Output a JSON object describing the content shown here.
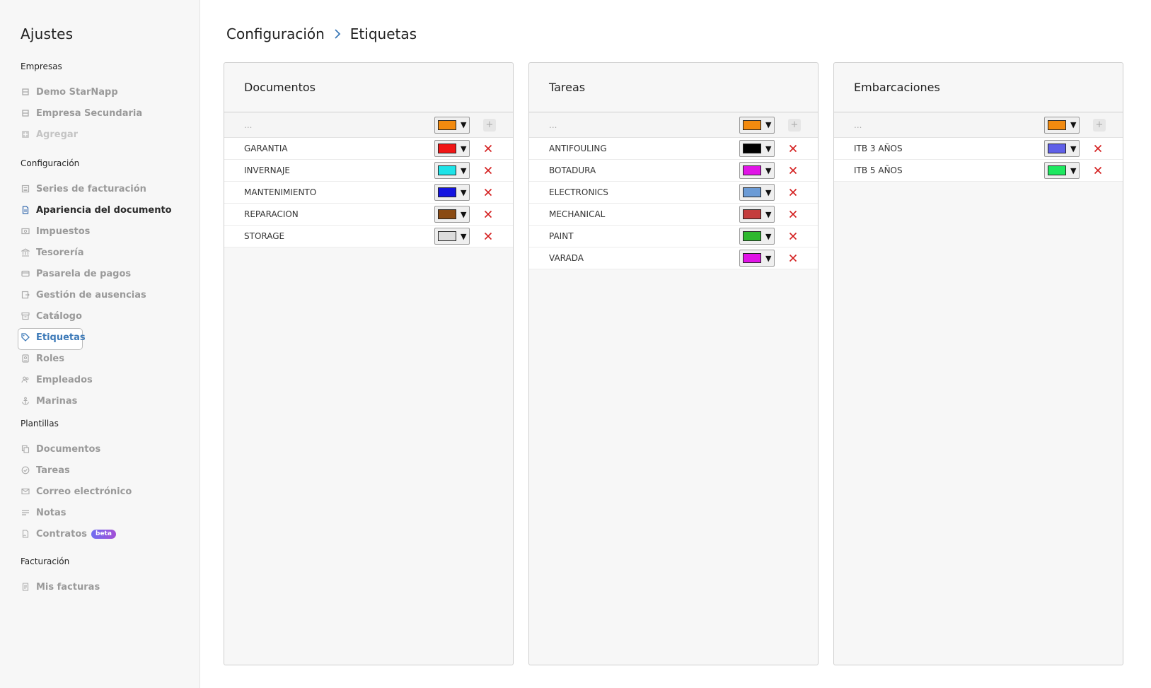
{
  "sidebar": {
    "title": "Ajustes",
    "sections": [
      {
        "title": "Empresas",
        "items": [
          {
            "label": "Demo StarNapp",
            "icon": "building-icon",
            "state": "normal"
          },
          {
            "label": "Empresa Secundaria",
            "icon": "building-icon",
            "state": "normal"
          },
          {
            "label": "Agregar",
            "icon": "plus-square-icon",
            "state": "disabled"
          }
        ]
      },
      {
        "title": "Configuración",
        "items": [
          {
            "label": "Series de facturación",
            "icon": "list-icon",
            "state": "normal"
          },
          {
            "label": "Apariencia del documento",
            "icon": "document-icon",
            "state": "dark"
          },
          {
            "label": "Impuestos",
            "icon": "money-icon",
            "state": "normal"
          },
          {
            "label": "Tesorería",
            "icon": "bank-icon",
            "state": "normal"
          },
          {
            "label": "Pasarela de pagos",
            "icon": "card-icon",
            "state": "normal"
          },
          {
            "label": "Gestión de ausencias",
            "icon": "calendar-out-icon",
            "state": "normal"
          },
          {
            "label": "Catálogo",
            "icon": "archive-icon",
            "state": "normal"
          },
          {
            "label": "Etiquetas",
            "icon": "tag-icon",
            "state": "active"
          },
          {
            "label": "Roles",
            "icon": "id-badge-icon",
            "state": "normal"
          },
          {
            "label": "Empleados",
            "icon": "users-icon",
            "state": "normal"
          },
          {
            "label": "Marinas",
            "icon": "anchor-icon",
            "state": "normal"
          }
        ]
      },
      {
        "title": "Plantillas",
        "items": [
          {
            "label": "Documentos",
            "icon": "copy-icon",
            "state": "normal"
          },
          {
            "label": "Tareas",
            "icon": "check-circle-icon",
            "state": "normal"
          },
          {
            "label": "Correo electrónico",
            "icon": "mail-icon",
            "state": "normal"
          },
          {
            "label": "Notas",
            "icon": "lines-icon",
            "state": "normal"
          },
          {
            "label": "Contratos",
            "icon": "contract-icon",
            "state": "normal",
            "badge": "beta"
          }
        ]
      },
      {
        "title": "Facturación",
        "items": [
          {
            "label": "Mis facturas",
            "icon": "invoice-icon",
            "state": "normal"
          }
        ]
      }
    ]
  },
  "breadcrumb": {
    "parent": "Configuración",
    "current": "Etiquetas"
  },
  "panels": [
    {
      "title": "Documentos",
      "new_placeholder": "...",
      "new_color": "#f28a0f",
      "tags": [
        {
          "label": "GARANTIA",
          "color": "#f01515"
        },
        {
          "label": "INVERNAJE",
          "color": "#1ee3e8"
        },
        {
          "label": "MANTENIMIENTO",
          "color": "#1414e0"
        },
        {
          "label": "REPARACION",
          "color": "#8a4a12"
        },
        {
          "label": "STORAGE",
          "color": "#dcdcdc"
        }
      ]
    },
    {
      "title": "Tareas",
      "new_placeholder": "...",
      "new_color": "#f28a0f",
      "tags": [
        {
          "label": "ANTIFOULING",
          "color": "#000000"
        },
        {
          "label": "BOTADURA",
          "color": "#e014e6"
        },
        {
          "label": "ELECTRONICS",
          "color": "#6b9bd6"
        },
        {
          "label": "MECHANICAL",
          "color": "#c43c3c"
        },
        {
          "label": "PAINT",
          "color": "#2eb82e"
        },
        {
          "label": "VARADA",
          "color": "#e014e6"
        }
      ]
    },
    {
      "title": "Embarcaciones",
      "new_placeholder": "...",
      "new_color": "#f28a0f",
      "tags": [
        {
          "label": "ITB 3 AÑOS",
          "color": "#6060e8"
        },
        {
          "label": "ITB 5 AÑOS",
          "color": "#1ee860"
        }
      ]
    }
  ],
  "actions": {
    "add": "+",
    "dropdown_arrow": "▼"
  }
}
